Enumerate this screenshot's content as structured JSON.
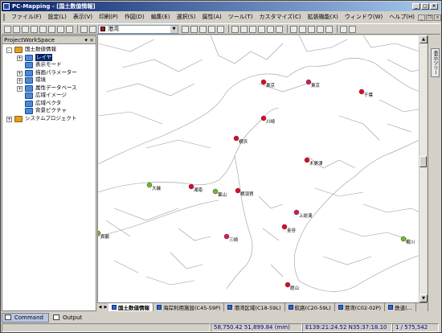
{
  "window": {
    "title": "PC-Mapping - [国土数值情報]"
  },
  "menu": [
    "ファイル(F)",
    "設定(L)",
    "表示(V)",
    "印刷(P)",
    "作図(D)",
    "編集(E)",
    "選択(S)",
    "属性(A)",
    "ツール(T)",
    "カスタマイズ(C)",
    "拡張機能(X)",
    "ウィンドウ(W)",
    "ヘルプ(H)"
  ],
  "toolbar": {
    "layer_combo": "港湾",
    "layer_color": "#d01010"
  },
  "panel": {
    "title": "ProjectWorkSpace",
    "tree": [
      {
        "label": "国土数値情報",
        "indent": 0,
        "expander": "-",
        "icon": "globe"
      },
      {
        "label": "レイヤ",
        "indent": 1,
        "expander": "+",
        "icon": "folder",
        "selected": true
      },
      {
        "label": "表示モード",
        "indent": 1,
        "expander": "",
        "icon": "folder"
      },
      {
        "label": "描画パラメーター",
        "indent": 1,
        "expander": "+",
        "icon": "folder"
      },
      {
        "label": "環境",
        "indent": 1,
        "expander": "+",
        "icon": "folder"
      },
      {
        "label": "属性データベース",
        "indent": 1,
        "expander": "+",
        "icon": "folder"
      },
      {
        "label": "広域イメージ",
        "indent": 1,
        "expander": "",
        "icon": "folder"
      },
      {
        "label": "広域ベクタ",
        "indent": 1,
        "expander": "",
        "icon": "folder"
      },
      {
        "label": "背景ピクチャ",
        "indent": 1,
        "expander": "",
        "icon": "folder"
      },
      {
        "label": "システムプロジェクト",
        "indent": 0,
        "expander": "+",
        "icon": "globe"
      }
    ]
  },
  "right_panel": {
    "label": "表示ツリー"
  },
  "map": {
    "ports": [
      {
        "label": "東京",
        "color": "#d01030"
      },
      {
        "label": "東京",
        "color": "#c02070"
      },
      {
        "label": "千葉",
        "color": "#d01030"
      },
      {
        "label": "川崎",
        "color": "#d01030"
      },
      {
        "label": "横浜",
        "color": "#d01030"
      },
      {
        "label": "木更津",
        "color": "#d01030"
      },
      {
        "label": "大磯",
        "color": "#60c030"
      },
      {
        "label": "湘南",
        "color": "#d01030"
      },
      {
        "label": "葉山",
        "color": "#60c030"
      },
      {
        "label": "横須賀",
        "color": "#d01030"
      },
      {
        "label": "上総湊",
        "color": "#c02070"
      },
      {
        "label": "真鶴",
        "color": "#60c030"
      },
      {
        "label": "三崎",
        "color": "#c02070"
      },
      {
        "label": "金谷",
        "color": "#d01030"
      },
      {
        "label": "館山",
        "color": "#d01030"
      },
      {
        "label": "鴨川",
        "color": "#60c030"
      },
      {
        "label": "勝浦",
        "color": "#d01030"
      }
    ]
  },
  "tabs": [
    "国土数値情報",
    "海岸利用施設(C45-59P)",
    "港湾区域(C18-59L)",
    "航路(C20-59L)",
    "港湾(C02-02P)",
    "鉄道(..."
  ],
  "bottom_tabs": [
    {
      "label": "Command",
      "active": true
    },
    {
      "label": "Output",
      "active": false
    }
  ],
  "status": {
    "empty": "",
    "coords": "58,750.42 51,899.84 (mm)",
    "latlon": "E139:21:24.52 N35:37:18.10",
    "page": "1 / 575,542"
  }
}
